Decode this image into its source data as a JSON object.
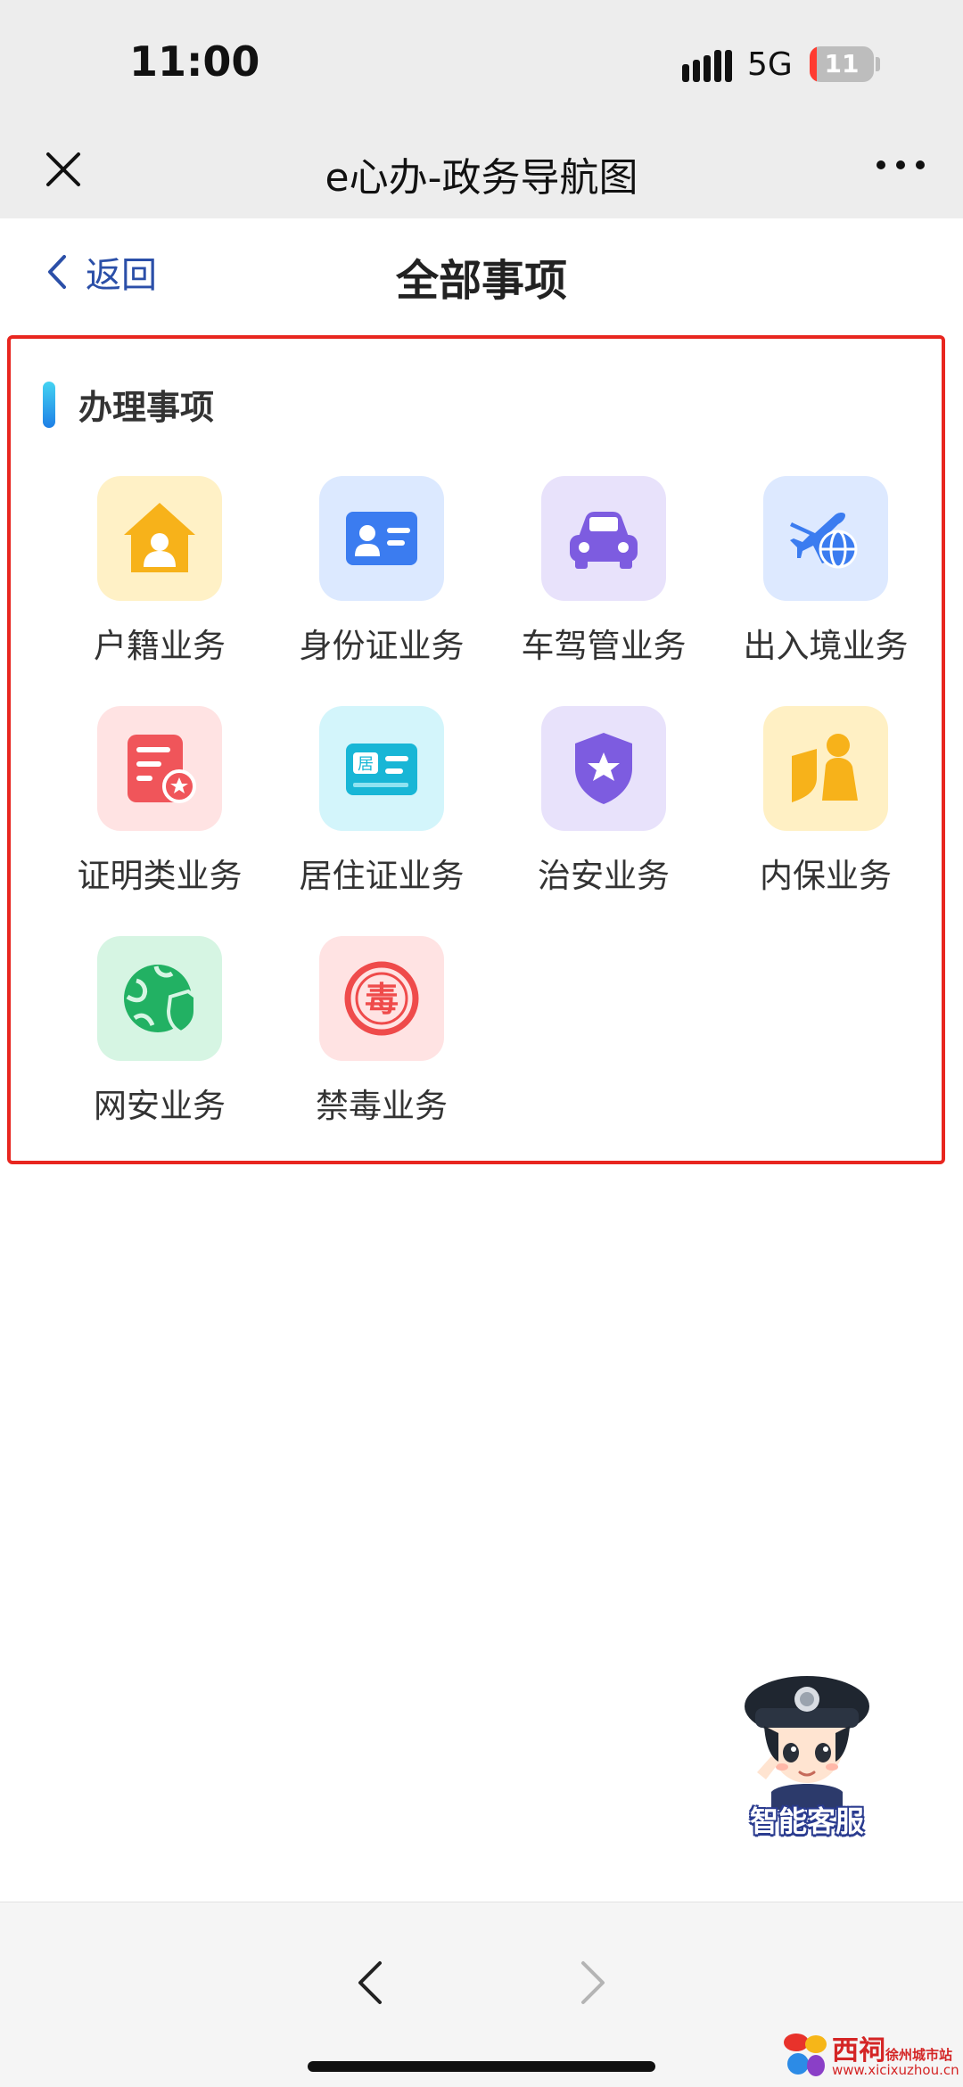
{
  "status_bar": {
    "time": "11:00",
    "network": "5G",
    "battery": "11",
    "battery_level": 0.11
  },
  "mini_program": {
    "title": "e心办-政务导航图"
  },
  "header": {
    "back_label": "返回",
    "title": "全部事项"
  },
  "section": {
    "title": "办理事项",
    "items": [
      {
        "label": "户籍业务",
        "icon": "household-house-icon",
        "bg": "#fff1c6",
        "color": "#f7b21a"
      },
      {
        "label": "身份证业务",
        "icon": "id-card-icon",
        "bg": "#dce9ff",
        "color": "#3b7cf0"
      },
      {
        "label": "车驾管业务",
        "icon": "car-icon",
        "bg": "#e8e2fb",
        "color": "#7d5ce0"
      },
      {
        "label": "出入境业务",
        "icon": "plane-globe-icon",
        "bg": "#dde9ff",
        "color": "#3b7cf0"
      },
      {
        "label": "证明类业务",
        "icon": "certificate-icon",
        "bg": "#ffe3e3",
        "color": "#f0555a"
      },
      {
        "label": "居住证业务",
        "icon": "residence-card-icon",
        "bg": "#d3f5fb",
        "color": "#18b6d6"
      },
      {
        "label": "治安业务",
        "icon": "police-badge-icon",
        "bg": "#e8e2fb",
        "color": "#7d5ce0"
      },
      {
        "label": "内保业务",
        "icon": "shield-person-icon",
        "bg": "#fff0c4",
        "color": "#f7b21a"
      },
      {
        "label": "网安业务",
        "icon": "globe-shield-icon",
        "bg": "#d6f5e3",
        "color": "#22b163"
      },
      {
        "label": "禁毒业务",
        "icon": "anti-drug-icon",
        "bg": "#ffe3e3",
        "color": "#ef4b4b",
        "glyph": "毒"
      }
    ]
  },
  "assistant": {
    "label": "智能客服"
  },
  "watermark": {
    "main": "西祠",
    "city": "徐州城市站",
    "url": "www.xicixuzhou.cn"
  },
  "colors": {
    "highlight_border": "#e8261f",
    "link": "#2b4fa8"
  }
}
